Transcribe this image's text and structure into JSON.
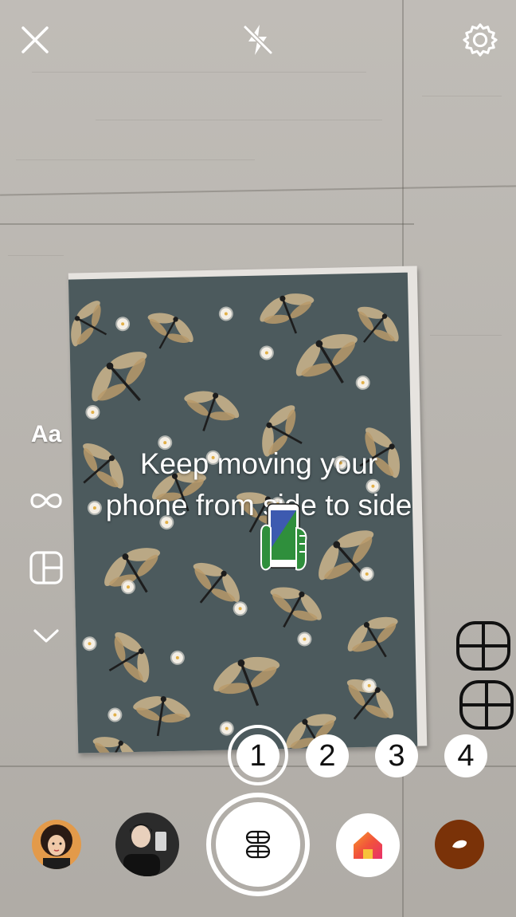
{
  "top_bar": {
    "close_icon": "close-icon",
    "flash_icon": "flash-off-icon",
    "settings_icon": "settings-gear-icon"
  },
  "tools": {
    "text_label": "Aa",
    "items": [
      "text-tool",
      "boomerang-infinity-icon",
      "layout-grid-icon",
      "chevron-down-icon"
    ]
  },
  "instruction": {
    "text": "Keep moving your phone from side to side"
  },
  "layout_options": {
    "icons": [
      "layout-grid-option-icon",
      "layout-grid-option-icon"
    ]
  },
  "counter": {
    "numbers": [
      "1",
      "2",
      "3",
      "4"
    ],
    "selected": "1"
  },
  "bottom_bar": {
    "shutter_icon": "layout-grid-icon",
    "effect_icons": [
      "avatar-effect",
      "avatar-effect",
      "home-effect-icon",
      "brown-effect-icon"
    ]
  },
  "colors": {
    "cover": "#4c5a5d",
    "floor": "#b9b5af",
    "accent_orange": "#f79a2a",
    "accent_pink": "#e8306a",
    "brown": "#7a3208"
  }
}
